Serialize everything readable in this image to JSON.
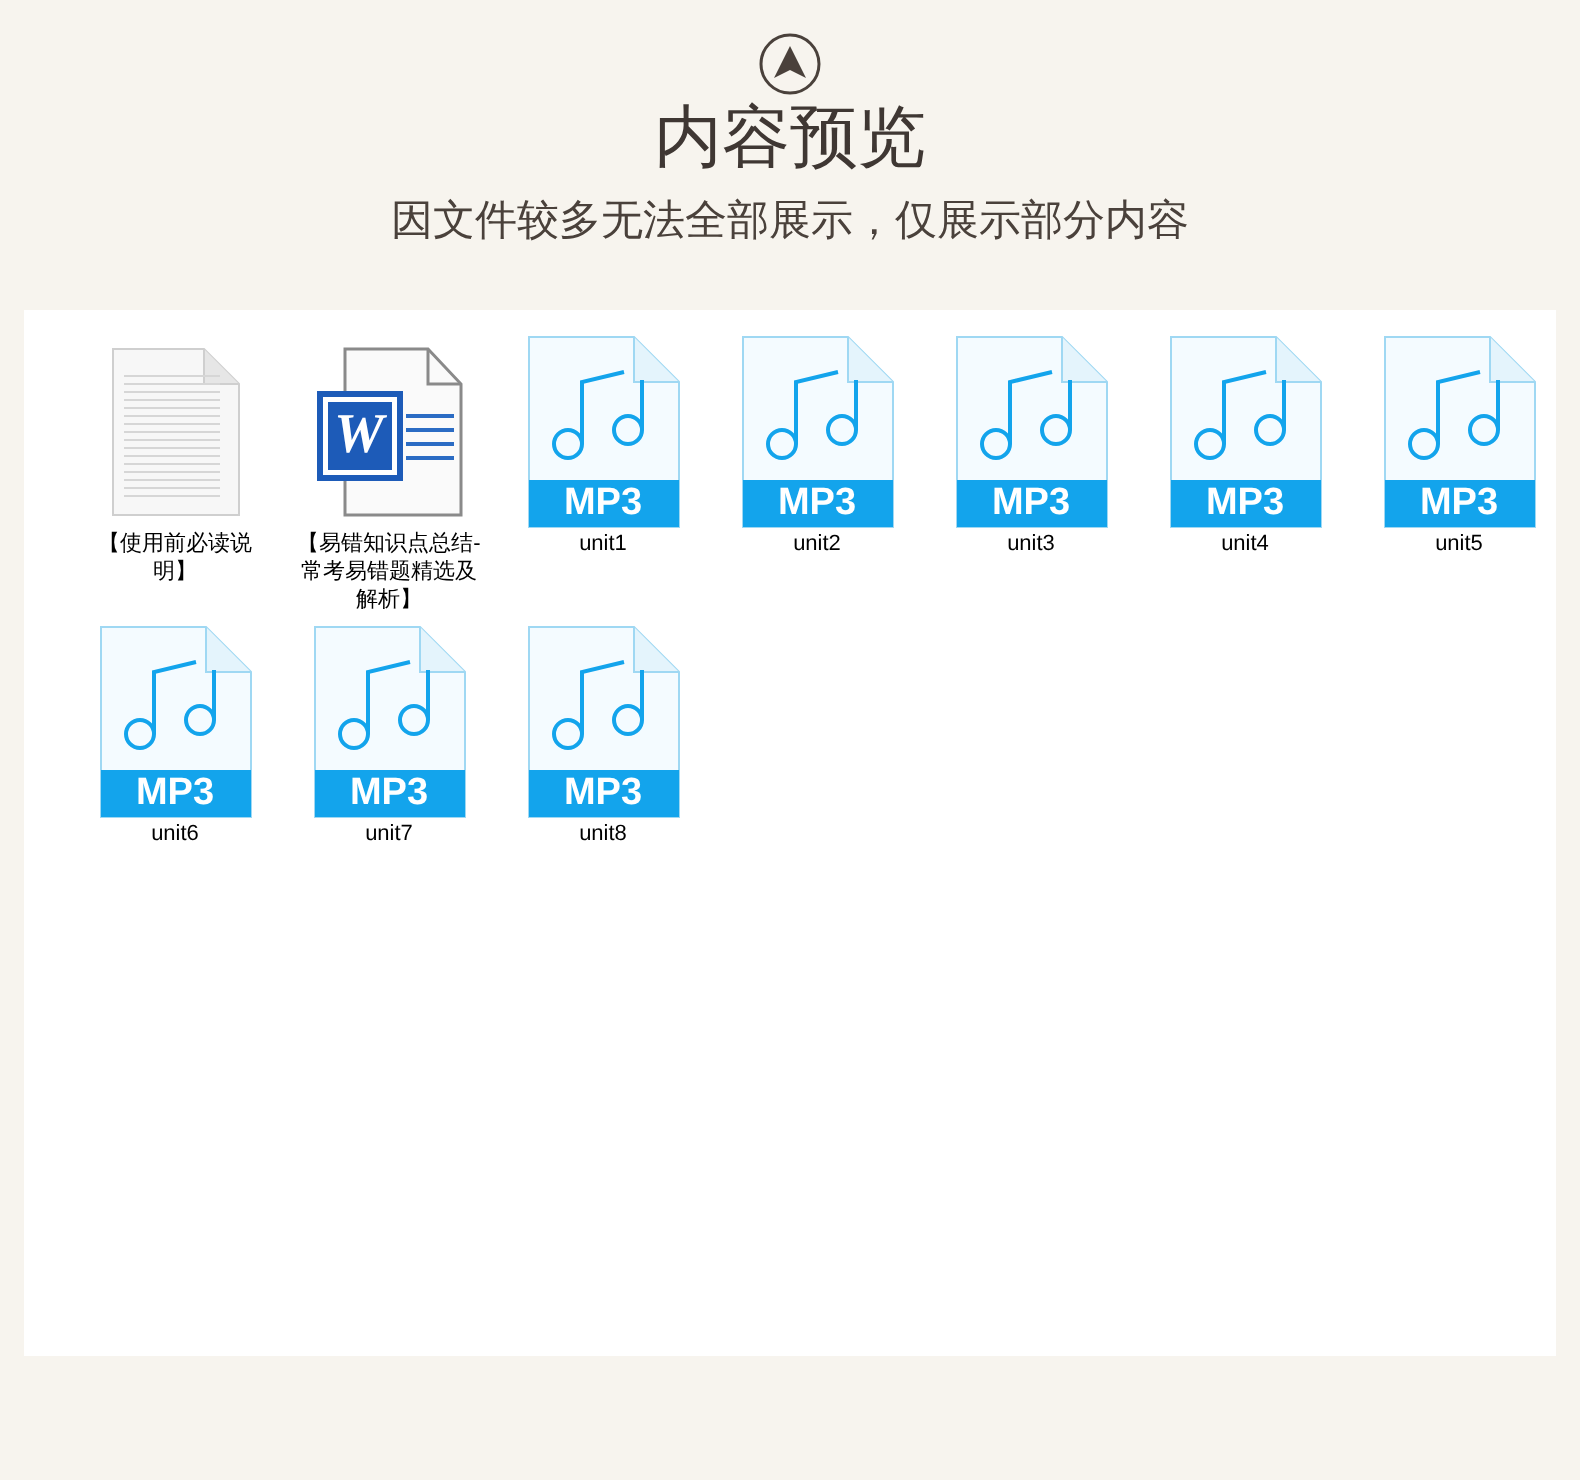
{
  "header": {
    "title": "内容预览",
    "subtitle": "因文件较多无法全部展示，仅展示部分内容"
  },
  "files": [
    {
      "kind": "text",
      "name": "【使用前必读说明】"
    },
    {
      "kind": "word",
      "name": "【易错知识点总结-常考易错题精选及解析】",
      "badge": "W"
    },
    {
      "kind": "mp3",
      "name": "unit1",
      "badge": "MP3"
    },
    {
      "kind": "mp3",
      "name": "unit2",
      "badge": "MP3"
    },
    {
      "kind": "mp3",
      "name": "unit3",
      "badge": "MP3"
    },
    {
      "kind": "mp3",
      "name": "unit4",
      "badge": "MP3"
    },
    {
      "kind": "mp3",
      "name": "unit5",
      "badge": "MP3"
    },
    {
      "kind": "mp3",
      "name": "unit6",
      "badge": "MP3"
    },
    {
      "kind": "mp3",
      "name": "unit7",
      "badge": "MP3"
    },
    {
      "kind": "mp3",
      "name": "unit8",
      "badge": "MP3"
    }
  ]
}
